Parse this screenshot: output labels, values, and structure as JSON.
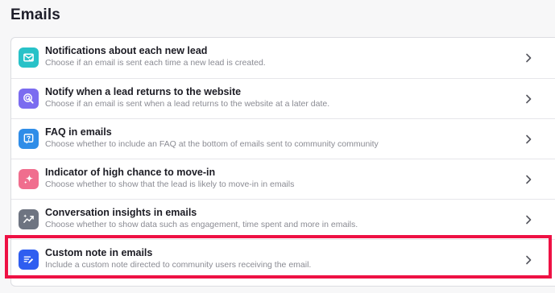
{
  "page": {
    "title": "Emails"
  },
  "settings": [
    {
      "title": "Notifications about each new lead",
      "description": "Choose if an email is sent each time a new lead is created.",
      "icon": "email-check-icon",
      "icon_color": "#28c2c8"
    },
    {
      "title": "Notify when a lead returns to the website",
      "description": "Choose if an email is sent when a lead returns to the website at a later date.",
      "icon": "cursor-click-icon",
      "icon_color": "#7b6cf0"
    },
    {
      "title": "FAQ in emails",
      "description": "Choose whether to include an FAQ at the bottom of emails sent to community community",
      "icon": "question-mark-icon",
      "icon_color": "#2f8de8"
    },
    {
      "title": "Indicator of high chance to move-in",
      "description": "Choose whether to show that the lead is likely to move-in in emails",
      "icon": "sparkles-icon",
      "icon_color": "#f06e8e"
    },
    {
      "title": "Conversation insights in emails",
      "description": "Choose whether to show data such as engagement, time spent and more in emails.",
      "icon": "trend-line-icon",
      "icon_color": "#6e7481"
    },
    {
      "title": "Custom note in emails",
      "description": "Include a custom note directed to community users receiving the email.",
      "icon": "note-pencil-icon",
      "icon_color": "#2f5ef0"
    }
  ],
  "highlight": {
    "color": "#ee1144",
    "target_index": 5
  }
}
